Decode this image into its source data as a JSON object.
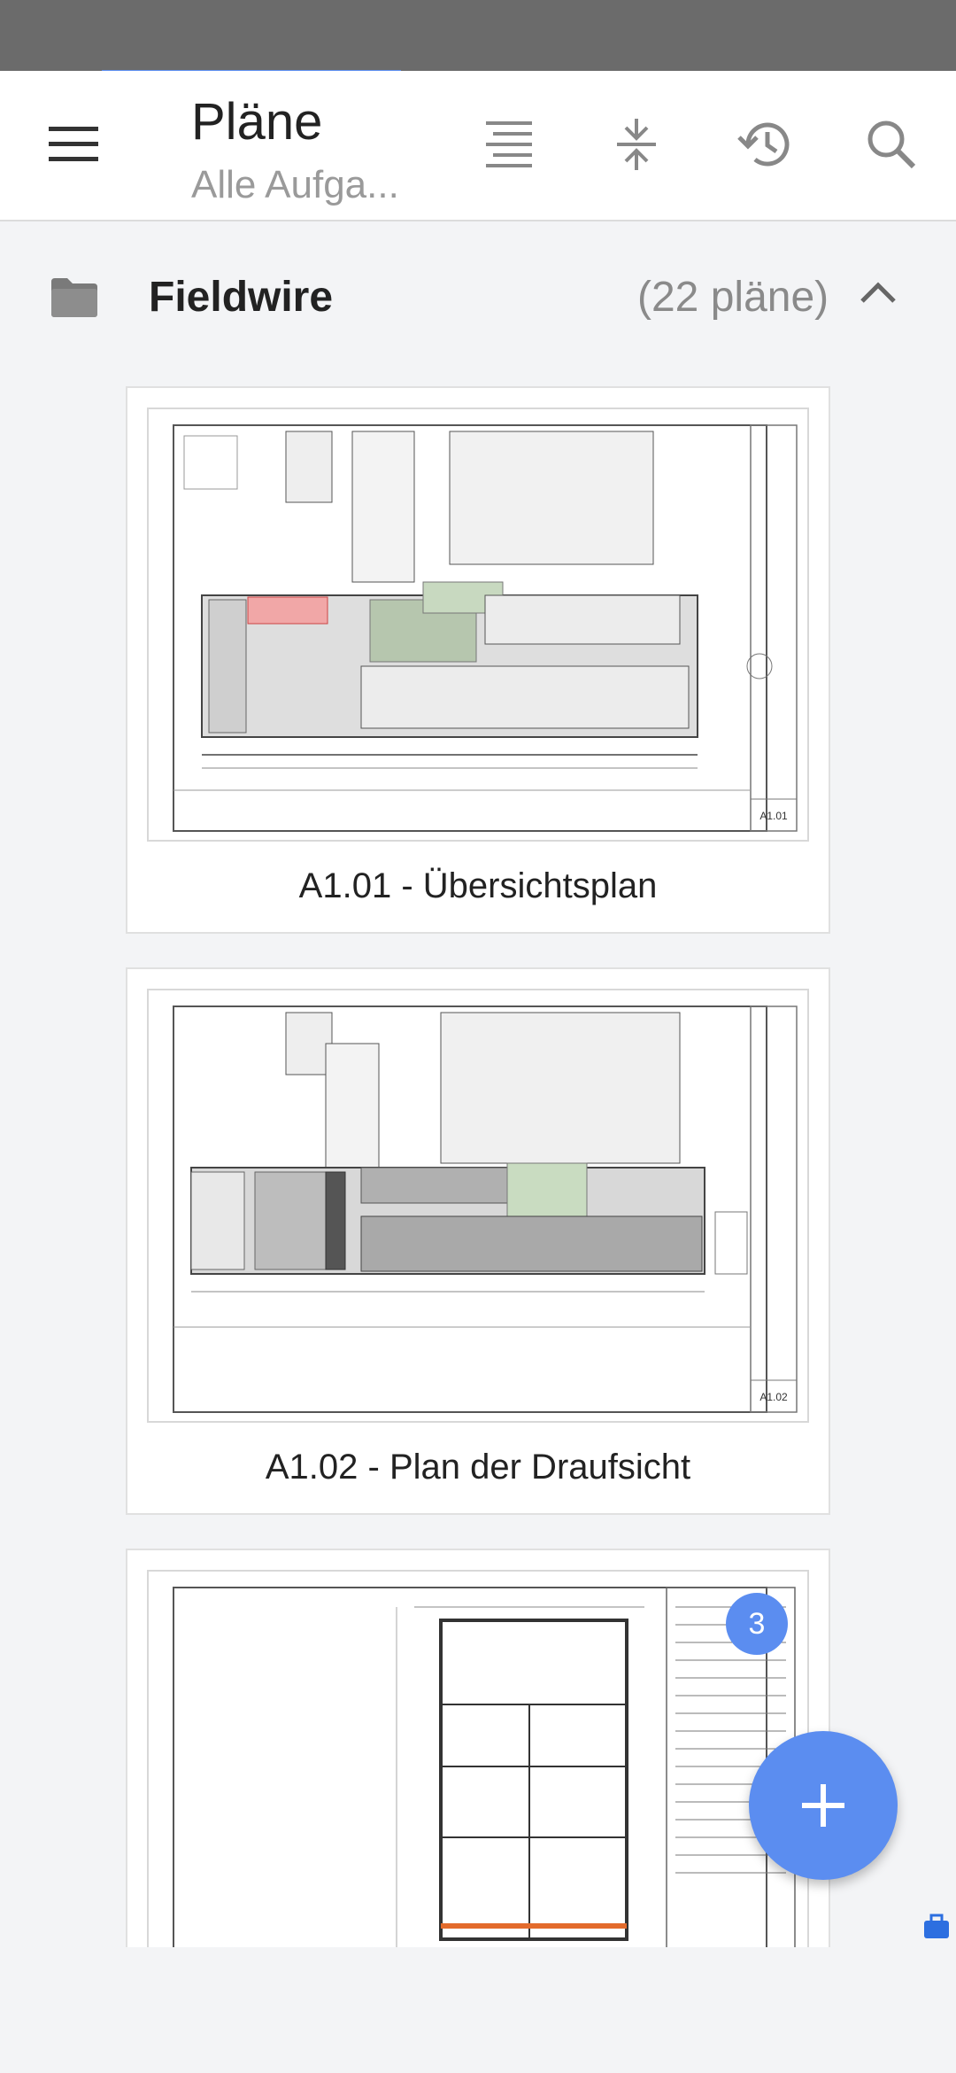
{
  "header": {
    "title": "Pläne",
    "subtitle": "Alle Aufga..."
  },
  "toolbar": {
    "icons": [
      "menu-icon",
      "filter-list-icon",
      "collapse-vertical-icon",
      "history-icon",
      "search-icon"
    ]
  },
  "folder": {
    "name": "Fieldwire",
    "count_label": "(22 pläne)"
  },
  "plans": [
    {
      "label": "A1.01 - Übersichtsplan",
      "sheet": "A1.01"
    },
    {
      "label": "A1.02 - Plan der Draufsicht",
      "sheet": "A1.02"
    },
    {
      "label": "",
      "sheet": ""
    }
  ],
  "badge": {
    "count": "3"
  },
  "colors": {
    "accent": "#5b8df0",
    "status_bar": "#6b6b6b",
    "background": "#f3f4f6"
  }
}
